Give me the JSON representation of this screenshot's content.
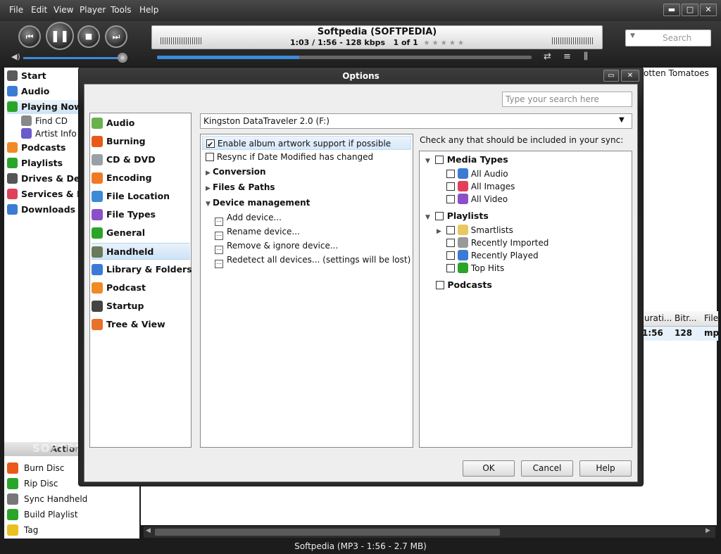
{
  "menu": [
    "File",
    "Edit",
    "View",
    "Player",
    "Tools",
    "Help"
  ],
  "window_controls": {
    "minimize": "▬",
    "maximize": "□",
    "close": "✕"
  },
  "player": {
    "title": "Softpedia (SOFTPEDIA)",
    "info": "1:03 / 1:56 - 128 kbps",
    "position": "1 of 1",
    "rating": "★ ★ ★ ★ ★",
    "progress_fraction": 0.38,
    "search_placeholder": "Search"
  },
  "tree": {
    "items": [
      {
        "label": "Start",
        "color": "#5b5b5b"
      },
      {
        "label": "Audio",
        "color": "#3b7bd4"
      },
      {
        "label": "Playing Now",
        "color": "#2aa52a"
      },
      {
        "label": "Find CD",
        "color": "#888888"
      },
      {
        "label": "Artist Info",
        "color": "#6a5acd"
      },
      {
        "label": "Podcasts",
        "color": "#f08a24"
      },
      {
        "label": "Playlists",
        "color": "#2aa52a"
      },
      {
        "label": "Drives & Dev",
        "color": "#555555"
      },
      {
        "label": "Services & Pl",
        "color": "#e0405a"
      },
      {
        "label": "Downloads",
        "color": "#3b7bd4"
      }
    ]
  },
  "action_window": {
    "header": "Action W",
    "items": [
      {
        "label": "Burn Disc",
        "color": "#e85a1a"
      },
      {
        "label": "Rip Disc",
        "color": "#2aa52a"
      },
      {
        "label": "Sync Handheld",
        "color": "#777777"
      },
      {
        "label": "Build Playlist",
        "color": "#2aa52a"
      },
      {
        "label": "Tag",
        "color": "#e8c020"
      }
    ]
  },
  "background_list": {
    "header_fragment": "otten Tomatoes",
    "columns": [
      "urati...",
      "Bitr...",
      "File"
    ],
    "row": [
      "1:56",
      "128",
      "mp"
    ]
  },
  "status_bar": "Softpedia (MP3 - 1:56 - 2.7 MB)",
  "watermark": "SOFTPEDIA",
  "dialog": {
    "title": "Options",
    "search_placeholder": "Type your search here",
    "categories": [
      {
        "label": "Audio",
        "color": "#6ab04c"
      },
      {
        "label": "Burning",
        "color": "#e85a1a"
      },
      {
        "label": "CD & DVD",
        "color": "#9aa0a6"
      },
      {
        "label": "Encoding",
        "color": "#f07a24"
      },
      {
        "label": "File Location",
        "color": "#3b8ad8"
      },
      {
        "label": "File Types",
        "color": "#8b4fc8"
      },
      {
        "label": "General",
        "color": "#2aa52a"
      },
      {
        "label": "Handheld",
        "color": "#6a7a5a"
      },
      {
        "label": "Library & Folders",
        "color": "#3b7bd4"
      },
      {
        "label": "Podcast",
        "color": "#f08a24"
      },
      {
        "label": "Startup",
        "color": "#444444"
      },
      {
        "label": "Tree & View",
        "color": "#e8702a"
      }
    ],
    "selected_category": "Handheld",
    "device": "Kingston DataTraveler 2.0 (F:)",
    "options": {
      "artwork": "Enable album artwork support if possible",
      "resync": "Resync if Date Modified has changed",
      "conversion": "Conversion",
      "files_paths": "Files & Paths",
      "device_mgmt": "Device management",
      "add_device": "Add device...",
      "rename_device": "Rename device...",
      "remove_device": "Remove & ignore device...",
      "redetect": "Redetect all devices... (settings will be lost)"
    },
    "sync_prompt": "Check any that should be included in your sync:",
    "sync_tree": {
      "media_types": "Media Types",
      "all_audio": "All Audio",
      "all_images": "All Images",
      "all_video": "All Video",
      "playlists": "Playlists",
      "smartlists": "Smartlists",
      "recently_imported": "Recently Imported",
      "recently_played": "Recently Played",
      "top_hits": "Top Hits",
      "podcasts": "Podcasts"
    },
    "buttons": {
      "ok": "OK",
      "cancel": "Cancel",
      "help": "Help"
    }
  }
}
